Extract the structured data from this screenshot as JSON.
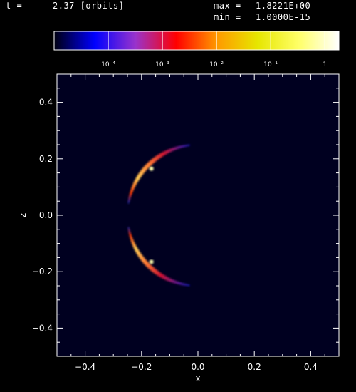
{
  "header": {
    "time_label": "t =",
    "time_value": "2.37 [orbits]",
    "max_label": "max =",
    "max_value": "1.8221E+00",
    "min_label": "min =",
    "min_value": "1.0000E-15"
  },
  "colorbar": {
    "tick_labels": [
      "10⁻⁴",
      "10⁻³",
      "10⁻²",
      "10⁻¹",
      "1"
    ],
    "tick_values": [
      0.0001,
      0.001,
      0.01,
      0.1,
      1
    ],
    "range": [
      1e-05,
      1.8221
    ],
    "scale": "log",
    "colors": [
      "#000010",
      "#0000ff",
      "#9933cc",
      "#ff0000",
      "#ff9900",
      "#e6e600",
      "#ffff66",
      "#ffffff"
    ]
  },
  "chart_data": {
    "type": "heatmap",
    "title": "",
    "xlabel": "x",
    "ylabel": "z",
    "xlim": [
      -0.5,
      0.5
    ],
    "ylim": [
      -0.5,
      0.5
    ],
    "x_ticks": [
      -0.4,
      -0.2,
      0.0,
      0.2,
      0.4
    ],
    "x_tick_labels": [
      "−0.4",
      "−0.2",
      "0.0",
      "0.2",
      "0.4"
    ],
    "y_ticks": [
      -0.4,
      -0.2,
      0.0,
      0.2,
      0.4
    ],
    "y_tick_labels": [
      "−0.4",
      "−0.2",
      "0.0",
      "0.2",
      "0.4"
    ],
    "background_color": "#000020",
    "features": [
      {
        "name": "upper arc",
        "shape": "arc",
        "radius": 0.25,
        "angle_range_deg": [
          97,
          170
        ],
        "stops": [
          {
            "angle_deg": 97,
            "color": "#2020d0"
          },
          {
            "angle_deg": 120,
            "color": "#cc1133"
          },
          {
            "angle_deg": 135,
            "color": "#ff7733"
          },
          {
            "angle_deg": 150,
            "color": "#ffcc55"
          },
          {
            "angle_deg": 163,
            "color": "#ff3300"
          },
          {
            "angle_deg": 170,
            "color": "#2233cc"
          }
        ]
      },
      {
        "name": "lower arc",
        "shape": "arc",
        "radius": 0.25,
        "angle_range_deg": [
          190,
          263
        ],
        "stops": [
          {
            "angle_deg": 190,
            "color": "#2233cc"
          },
          {
            "angle_deg": 197,
            "color": "#ff3300"
          },
          {
            "angle_deg": 210,
            "color": "#ffcc55"
          },
          {
            "angle_deg": 225,
            "color": "#ff7733"
          },
          {
            "angle_deg": 240,
            "color": "#cc1133"
          },
          {
            "angle_deg": 263,
            "color": "#2020d0"
          }
        ]
      }
    ],
    "hot_spots": [
      {
        "x": -0.165,
        "y": 0.165
      },
      {
        "x": -0.165,
        "y": -0.165
      }
    ]
  }
}
